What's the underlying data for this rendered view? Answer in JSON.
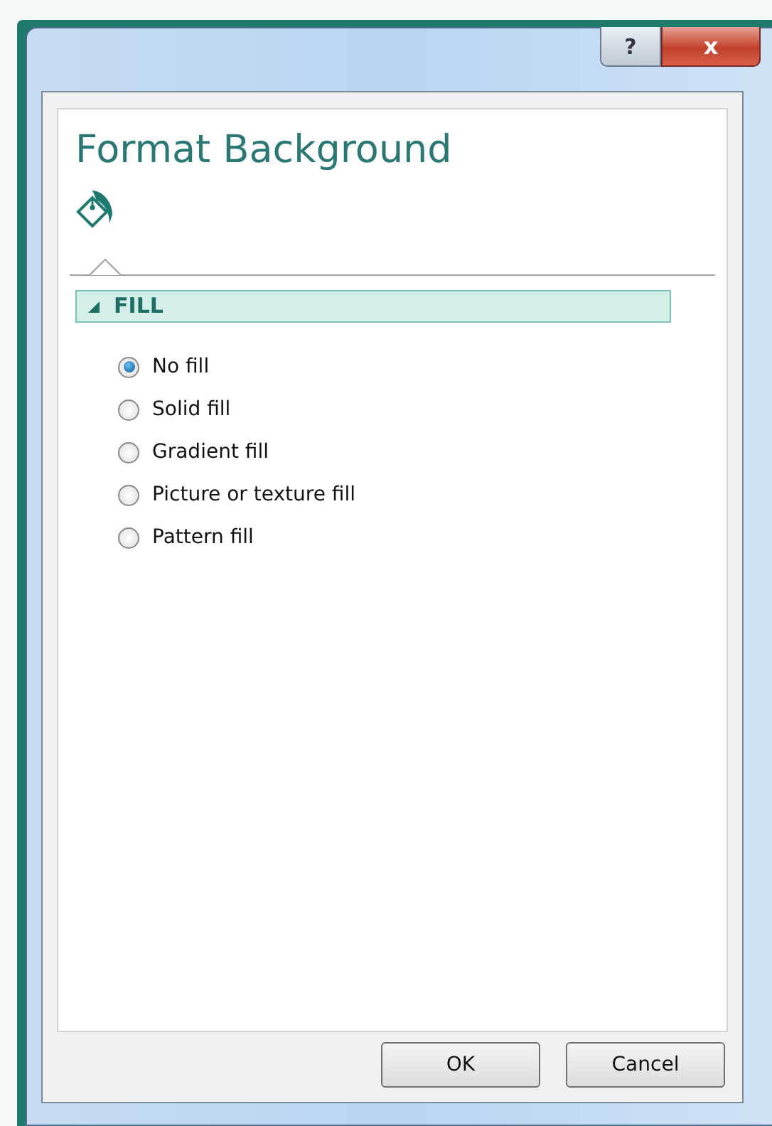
{
  "window": {
    "help_button": "?",
    "close_button": "x"
  },
  "pane": {
    "title": "Format Background"
  },
  "section": {
    "label": "FILL",
    "expanded": true
  },
  "options": [
    {
      "label": "No fill",
      "selected": true
    },
    {
      "label": "Solid fill",
      "selected": false
    },
    {
      "label": "Gradient fill",
      "selected": false
    },
    {
      "label": "Picture or texture fill",
      "selected": false
    },
    {
      "label": "Pattern fill",
      "selected": false
    }
  ],
  "buttons": [
    "OK",
    "Cancel"
  ]
}
